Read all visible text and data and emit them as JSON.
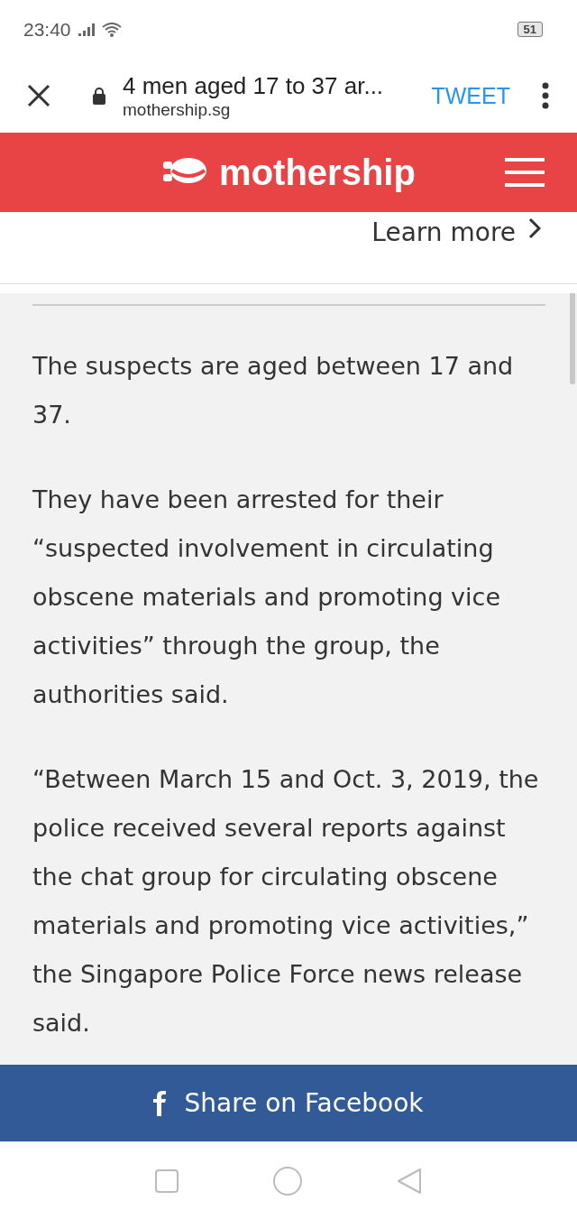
{
  "status_bar": {
    "time": "23:40",
    "battery": "51"
  },
  "toolbar": {
    "title": "4 men aged 17 to 37 ar...",
    "url": "mothership.sg",
    "action": "TWEET"
  },
  "header": {
    "logo": "mothership"
  },
  "ad": {
    "link": "Learn more"
  },
  "article": {
    "paragraphs": [
      "The suspects are aged between 17 and 37.",
      "They have been arrested for their “suspected involvement in circulating obscene materials and promoting vice activities” through the group, the authorities said.",
      "“Between March 15 and Oct. 3, 2019, the police received several reports against the chat group for circulating obscene materials and promoting vice activities,” the Singapore Police Force news release said."
    ]
  },
  "share_button": {
    "label": "Share on Facebook"
  }
}
